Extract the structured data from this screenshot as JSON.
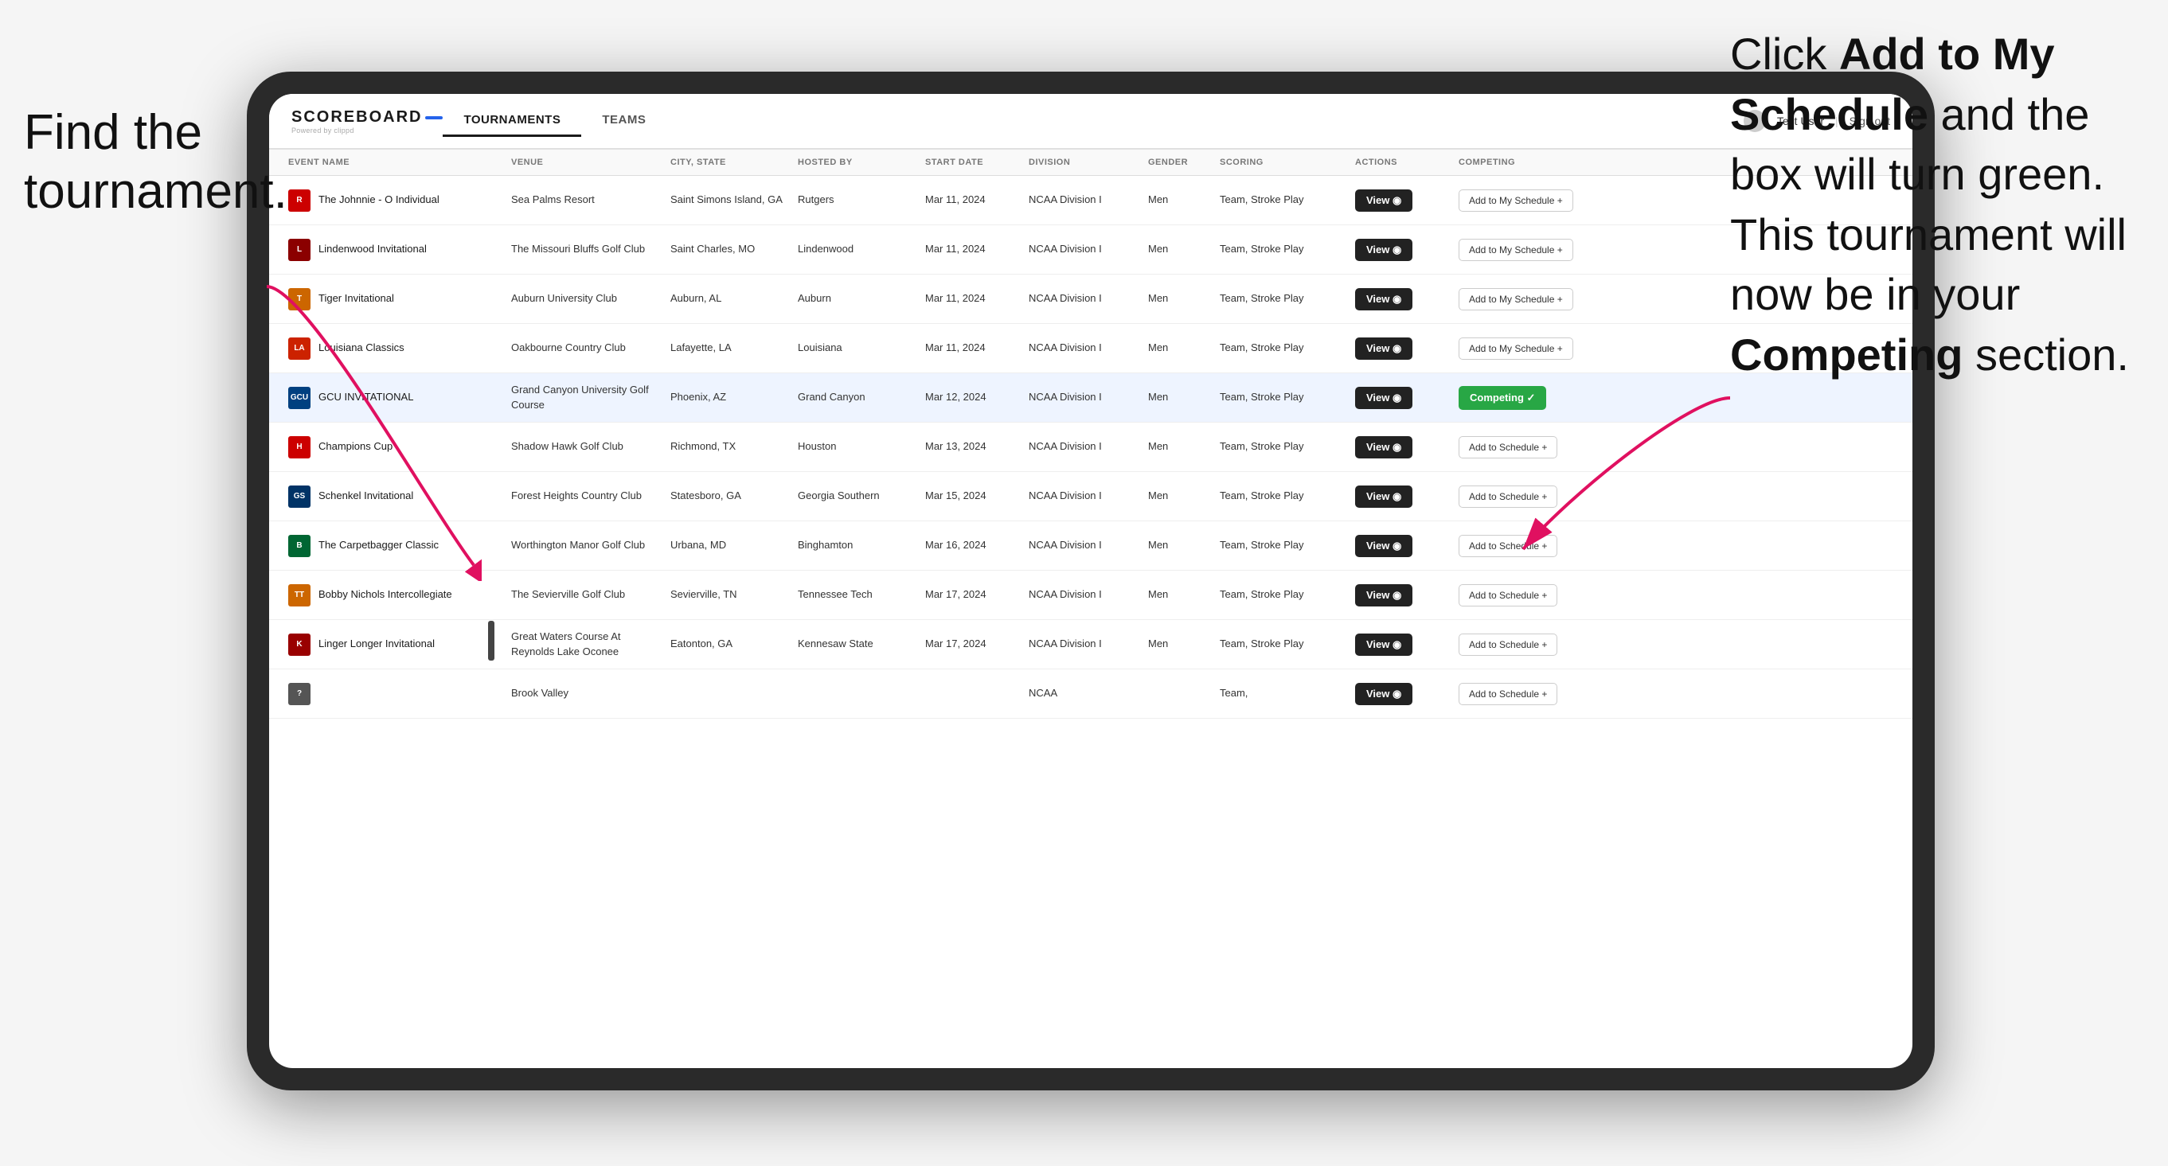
{
  "left_annotation": "Find the\ntournament.",
  "right_annotation_line1": "Click ",
  "right_annotation_bold1": "Add to My\nSchedule",
  "right_annotation_line2": " and the\nbox will turn green.\nThis tournament\nwill now be in\nyour ",
  "right_annotation_bold2": "Competing",
  "right_annotation_line3": "\nsection.",
  "nav": {
    "logo": "SCOREBOARD",
    "logo_sub": "Powered by clippd",
    "tabs": [
      "TOURNAMENTS",
      "TEAMS"
    ],
    "active_tab": "TOURNAMENTS",
    "user_label": "Test User",
    "signout_label": "Sign out"
  },
  "table": {
    "columns": [
      "EVENT NAME",
      "VENUE",
      "CITY, STATE",
      "HOSTED BY",
      "START DATE",
      "DIVISION",
      "GENDER",
      "SCORING",
      "ACTIONS",
      "COMPETING"
    ],
    "rows": [
      {
        "logo_color": "#cc0000",
        "logo_text": "R",
        "event": "The Johnnie - O Individual",
        "venue": "Sea Palms Resort",
        "city_state": "Saint Simons Island, GA",
        "hosted_by": "Rutgers",
        "start_date": "Mar 11, 2024",
        "division": "NCAA Division I",
        "gender": "Men",
        "scoring": "Team, Stroke Play",
        "action": "View",
        "competing_type": "add",
        "competing_label": "Add to My Schedule +"
      },
      {
        "logo_color": "#8b0000",
        "logo_text": "L",
        "event": "Lindenwood Invitational",
        "venue": "The Missouri Bluffs Golf Club",
        "city_state": "Saint Charles, MO",
        "hosted_by": "Lindenwood",
        "start_date": "Mar 11, 2024",
        "division": "NCAA Division I",
        "gender": "Men",
        "scoring": "Team, Stroke Play",
        "action": "View",
        "competing_type": "add",
        "competing_label": "Add to My Schedule +"
      },
      {
        "logo_color": "#cc6600",
        "logo_text": "T",
        "event": "Tiger Invitational",
        "venue": "Auburn University Club",
        "city_state": "Auburn, AL",
        "hosted_by": "Auburn",
        "start_date": "Mar 11, 2024",
        "division": "NCAA Division I",
        "gender": "Men",
        "scoring": "Team, Stroke Play",
        "action": "View",
        "competing_type": "add",
        "competing_label": "Add to My Schedule +"
      },
      {
        "logo_color": "#cc2200",
        "logo_text": "LA",
        "event": "Louisiana Classics",
        "venue": "Oakbourne Country Club",
        "city_state": "Lafayette, LA",
        "hosted_by": "Louisiana",
        "start_date": "Mar 11, 2024",
        "division": "NCAA Division I",
        "gender": "Men",
        "scoring": "Team, Stroke Play",
        "action": "View",
        "competing_type": "add",
        "competing_label": "Add to My Schedule +"
      },
      {
        "logo_color": "#004080",
        "logo_text": "GCU",
        "event": "GCU INVITATIONAL",
        "venue": "Grand Canyon University Golf Course",
        "city_state": "Phoenix, AZ",
        "hosted_by": "Grand Canyon",
        "start_date": "Mar 12, 2024",
        "division": "NCAA Division I",
        "gender": "Men",
        "scoring": "Team, Stroke Play",
        "action": "View",
        "competing_type": "competing",
        "competing_label": "Competing ✓",
        "highlighted": true
      },
      {
        "logo_color": "#cc0000",
        "logo_text": "H",
        "event": "Champions Cup",
        "venue": "Shadow Hawk Golf Club",
        "city_state": "Richmond, TX",
        "hosted_by": "Houston",
        "start_date": "Mar 13, 2024",
        "division": "NCAA Division I",
        "gender": "Men",
        "scoring": "Team, Stroke Play",
        "action": "View",
        "competing_type": "add",
        "competing_label": "Add to Schedule +"
      },
      {
        "logo_color": "#003366",
        "logo_text": "GS",
        "event": "Schenkel Invitational",
        "venue": "Forest Heights Country Club",
        "city_state": "Statesboro, GA",
        "hosted_by": "Georgia Southern",
        "start_date": "Mar 15, 2024",
        "division": "NCAA Division I",
        "gender": "Men",
        "scoring": "Team, Stroke Play",
        "action": "View",
        "competing_type": "add",
        "competing_label": "Add to Schedule +"
      },
      {
        "logo_color": "#006633",
        "logo_text": "B",
        "event": "The Carpetbagger Classic",
        "venue": "Worthington Manor Golf Club",
        "city_state": "Urbana, MD",
        "hosted_by": "Binghamton",
        "start_date": "Mar 16, 2024",
        "division": "NCAA Division I",
        "gender": "Men",
        "scoring": "Team, Stroke Play",
        "action": "View",
        "competing_type": "add",
        "competing_label": "Add to Schedule +"
      },
      {
        "logo_color": "#cc6600",
        "logo_text": "TT",
        "event": "Bobby Nichols Intercollegiate",
        "venue": "The Sevierville Golf Club",
        "city_state": "Sevierville, TN",
        "hosted_by": "Tennessee Tech",
        "start_date": "Mar 17, 2024",
        "division": "NCAA Division I",
        "gender": "Men",
        "scoring": "Team, Stroke Play",
        "action": "View",
        "competing_type": "add",
        "competing_label": "Add to Schedule +"
      },
      {
        "logo_color": "#990000",
        "logo_text": "K",
        "event": "Linger Longer Invitational",
        "venue": "Great Waters Course At Reynolds Lake Oconee",
        "city_state": "Eatonton, GA",
        "hosted_by": "Kennesaw State",
        "start_date": "Mar 17, 2024",
        "division": "NCAA Division I",
        "gender": "Men",
        "scoring": "Team, Stroke Play",
        "action": "View",
        "competing_type": "add",
        "competing_label": "Add to Schedule +"
      },
      {
        "logo_color": "#555555",
        "logo_text": "?",
        "event": "",
        "venue": "Brook Valley",
        "city_state": "",
        "hosted_by": "",
        "start_date": "",
        "division": "NCAA",
        "gender": "",
        "scoring": "Team,",
        "action": "View",
        "competing_type": "add",
        "competing_label": "Add to Schedule +"
      }
    ]
  }
}
